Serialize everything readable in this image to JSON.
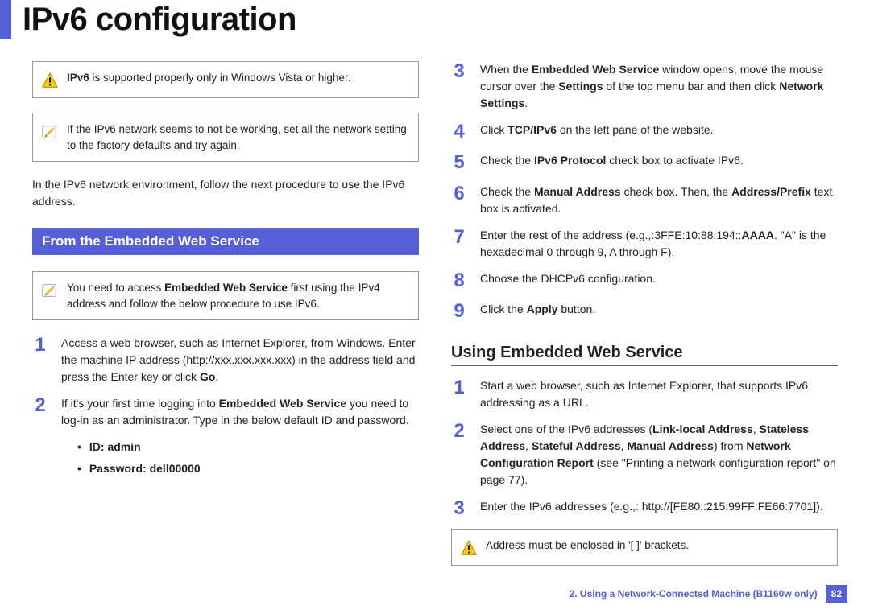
{
  "title": "IPv6 configuration",
  "leftCol": {
    "warning": "<b>IPv6</b> is supported properly only in Windows Vista or higher.",
    "tip": "If the IPv6 network seems to not be working, set all the network setting to the factory defaults and try again.",
    "intro": "In the IPv6 network environment, follow the next procedure to use the IPv6 address.",
    "sectionHeader": "From the Embedded Web Service",
    "accessNote": "You need to access <b>Embedded Web Service</b> first using the IPv4 address and follow the below procedure to use IPv6.",
    "steps": {
      "s1": {
        "num": "1",
        "body": "Access a web browser, such as Internet Explorer, from Windows.  Enter the machine IP address (http://xxx.xxx.xxx.xxx) in the address field and press the Enter key or click <b>Go</b>."
      },
      "s2": {
        "num": "2",
        "body": "If it's your first time logging into <b>Embedded Web Service</b> you need to log-in as an administrator.  Type in the below default ID and password.",
        "bullets": {
          "b1": "ID: admin",
          "b2": "Password: dell00000"
        }
      }
    }
  },
  "rightCol": {
    "stepsA": {
      "s3": {
        "num": "3",
        "body": "When the <b>Embedded Web Service</b> window opens, move the mouse cursor over the <b>Settings</b> of the top menu bar and then click <b>Network Settings</b>."
      },
      "s4": {
        "num": "4",
        "body": "Click <b>TCP/IPv6</b> on the left pane of the website."
      },
      "s5": {
        "num": "5",
        "body": "Check the <b>IPv6 Protocol</b> check box to activate IPv6."
      },
      "s6": {
        "num": "6",
        "body": "Check the <b>Manual Address</b> check box. Then, the <b>Address/Prefix</b> text box is activated."
      },
      "s7": {
        "num": "7",
        "body": "Enter the rest of the address (e.g.,:3FFE:10:88:194::<b>AAAA</b>. \"A\" is the hexadecimal 0 through 9, A through F)."
      },
      "s8": {
        "num": "8",
        "body": "Choose the DHCPv6 configuration."
      },
      "s9": {
        "num": "9",
        "body": "Click the <b>Apply</b> button."
      }
    },
    "subHeader": "Using Embedded Web Service",
    "stepsB": {
      "s1": {
        "num": "1",
        "body": "Start a web browser, such as Internet Explorer, that supports IPv6 addressing as a URL."
      },
      "s2": {
        "num": "2",
        "body": "Select one of the IPv6 addresses (<b>Link-local Address</b>, <b>Stateless Address</b>, <b>Stateful Address</b>, <b>Manual Address</b>) from <b>Network Configuration Report</b> (see \"Printing a network configuration report\" on page 77)."
      },
      "s3": {
        "num": "3",
        "body": "Enter the IPv6 addresses (e.g.,: http://[FE80::215:99FF:FE66:7701])."
      }
    },
    "bracketWarning": "Address must be enclosed in '[ ]' brackets."
  },
  "footer": {
    "chapter": "2.  Using a Network-Connected Machine (B1160w only)",
    "pageNumber": "82"
  }
}
